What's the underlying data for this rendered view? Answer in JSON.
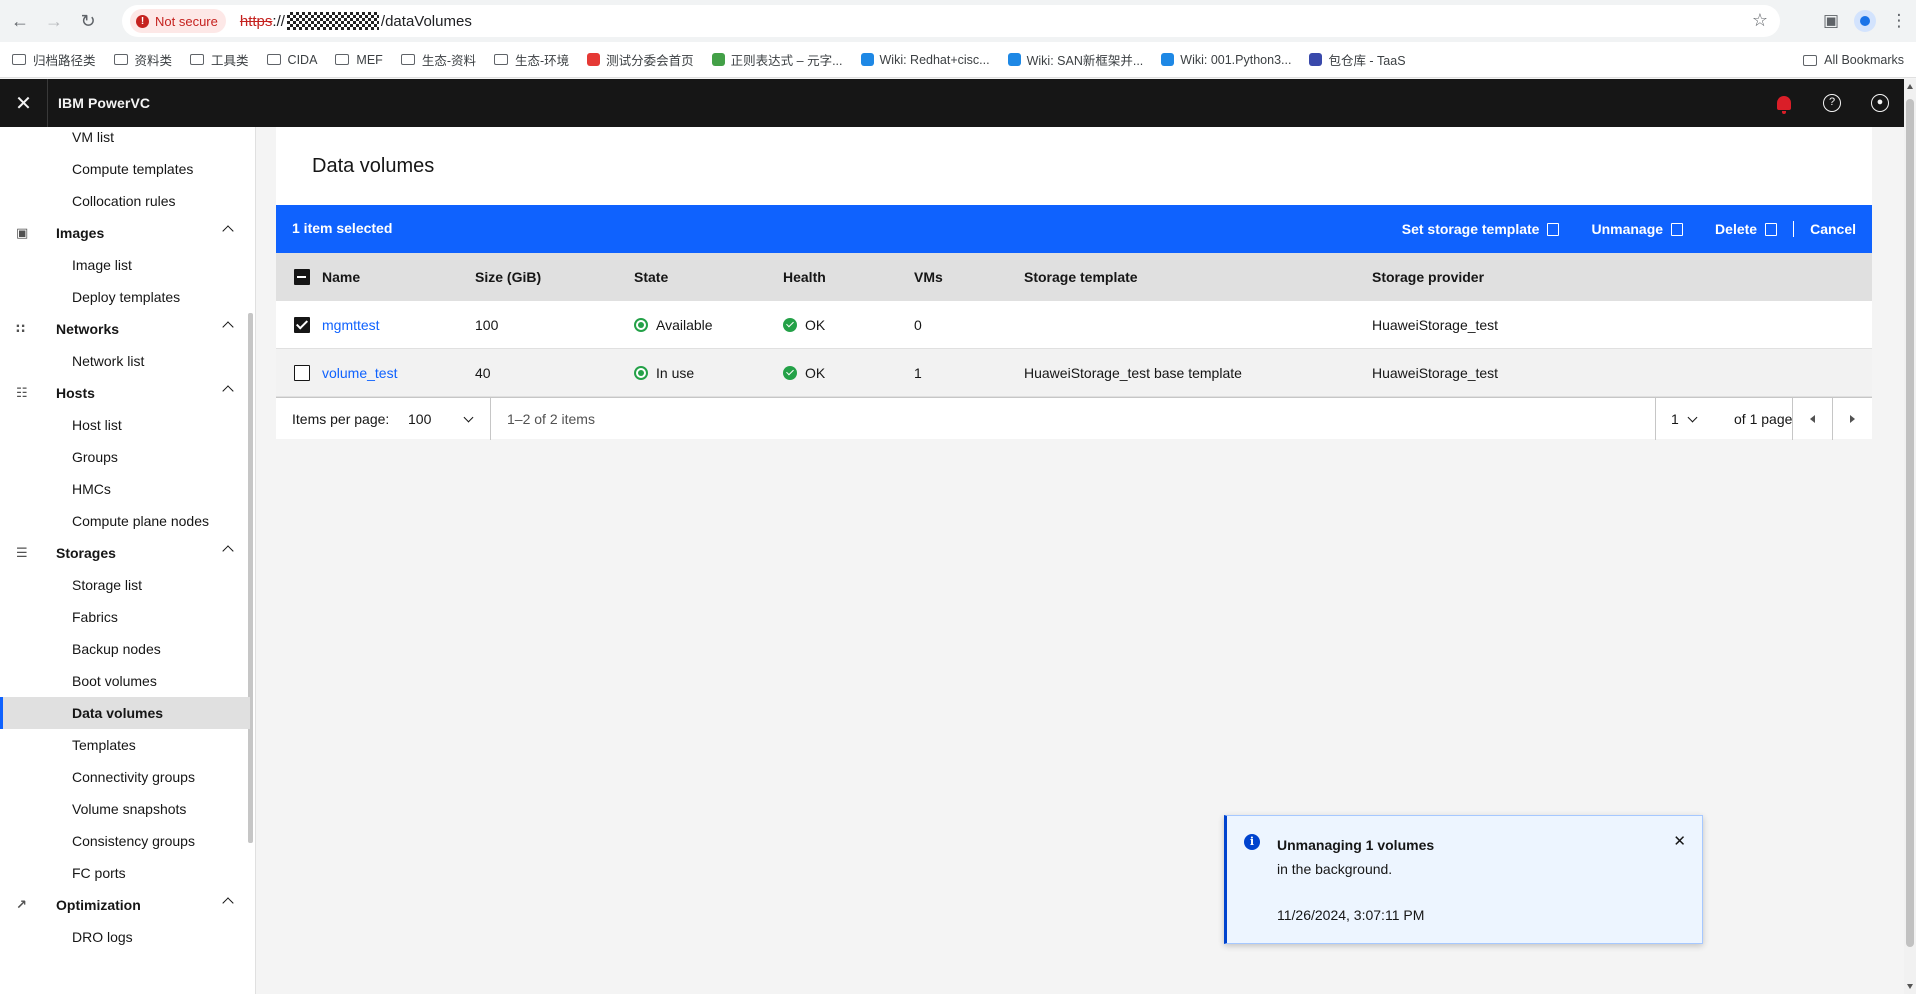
{
  "browser": {
    "security_label": "Not secure",
    "url_scheme": "https",
    "url_sep": "://",
    "url_path": "/dataVolumes",
    "bookmarks": [
      {
        "label": "归档路径类",
        "type": "folder"
      },
      {
        "label": "资料类",
        "type": "folder"
      },
      {
        "label": "工具类",
        "type": "folder"
      },
      {
        "label": "CIDA",
        "type": "folder"
      },
      {
        "label": "MEF",
        "type": "folder"
      },
      {
        "label": "生态-资料",
        "type": "folder"
      },
      {
        "label": "生态-环境",
        "type": "folder"
      },
      {
        "label": "测试分委会首页",
        "type": "link",
        "color": "#e53935"
      },
      {
        "label": "正则表达式 – 元字...",
        "type": "link",
        "color": "#43a047"
      },
      {
        "label": "Wiki: Redhat+cisc...",
        "type": "link",
        "color": "#1e88e5"
      },
      {
        "label": "Wiki: SAN新框架并...",
        "type": "link",
        "color": "#1e88e5"
      },
      {
        "label": "Wiki: 001.Python3...",
        "type": "link",
        "color": "#1e88e5"
      },
      {
        "label": "包仓库 - TaaS",
        "type": "link",
        "color": "#3949ab"
      }
    ],
    "all_bookmarks": "All Bookmarks"
  },
  "header": {
    "brand": "IBM PowerVC"
  },
  "sidebar": {
    "items": [
      {
        "label": "VM list",
        "kind": "sub"
      },
      {
        "label": "Compute templates",
        "kind": "sub"
      },
      {
        "label": "Collocation rules",
        "kind": "sub"
      },
      {
        "label": "Images",
        "kind": "cat",
        "icon": "camera-icon"
      },
      {
        "label": "Image list",
        "kind": "sub"
      },
      {
        "label": "Deploy templates",
        "kind": "sub"
      },
      {
        "label": "Networks",
        "kind": "cat",
        "icon": "network-icon"
      },
      {
        "label": "Network list",
        "kind": "sub"
      },
      {
        "label": "Hosts",
        "kind": "cat",
        "icon": "host-icon"
      },
      {
        "label": "Host list",
        "kind": "sub"
      },
      {
        "label": "Groups",
        "kind": "sub"
      },
      {
        "label": "HMCs",
        "kind": "sub"
      },
      {
        "label": "Compute plane nodes",
        "kind": "sub"
      },
      {
        "label": "Storages",
        "kind": "cat",
        "icon": "storage-icon"
      },
      {
        "label": "Storage list",
        "kind": "sub"
      },
      {
        "label": "Fabrics",
        "kind": "sub"
      },
      {
        "label": "Backup nodes",
        "kind": "sub"
      },
      {
        "label": "Boot volumes",
        "kind": "sub"
      },
      {
        "label": "Data volumes",
        "kind": "sub",
        "active": true
      },
      {
        "label": "Templates",
        "kind": "sub"
      },
      {
        "label": "Connectivity groups",
        "kind": "sub"
      },
      {
        "label": "Volume snapshots",
        "kind": "sub"
      },
      {
        "label": "Consistency groups",
        "kind": "sub"
      },
      {
        "label": "FC ports",
        "kind": "sub"
      },
      {
        "label": "Optimization",
        "kind": "cat",
        "icon": "chart-icon"
      },
      {
        "label": "DRO logs",
        "kind": "sub"
      }
    ]
  },
  "main": {
    "title": "Data volumes",
    "batch": {
      "count": "1 item selected",
      "set_template": "Set storage template",
      "unmanage": "Unmanage",
      "delete": "Delete",
      "cancel": "Cancel"
    },
    "table": {
      "headers": {
        "name": "Name",
        "size": "Size (GiB)",
        "state": "State",
        "health": "Health",
        "vms": "VMs",
        "template": "Storage template",
        "provider": "Storage provider"
      },
      "rows": [
        {
          "checked": true,
          "name": "mgmttest",
          "size": "100",
          "state": "Available",
          "health": "OK",
          "vms": "0",
          "template": "",
          "provider": "HuaweiStorage_test"
        },
        {
          "checked": false,
          "name": "volume_test",
          "size": "40",
          "state": "In use",
          "health": "OK",
          "vms": "1",
          "template": "HuaweiStorage_test base template",
          "provider": "HuaweiStorage_test"
        }
      ]
    },
    "pagination": {
      "items_per_page_label": "Items per page:",
      "items_per_page": "100",
      "range": "1–2 of 2 items",
      "page": "1",
      "of_pages": "of 1 page"
    }
  },
  "toast": {
    "title": "Unmanaging 1 volumes",
    "subtitle": "in the background.",
    "timestamp": "11/26/2024, 3:07:11 PM"
  },
  "colors": {
    "primary": "#0f62fe",
    "header_bg": "#161616",
    "success": "#24a148",
    "alert": "#da1e28"
  }
}
